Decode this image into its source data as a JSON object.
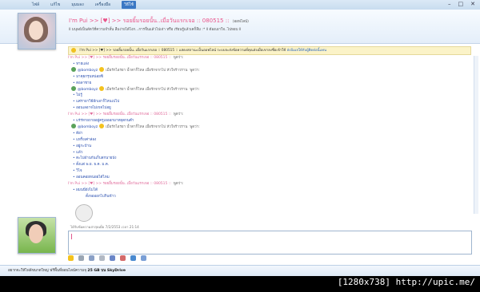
{
  "menu": [
    "ไฟล์",
    "แก้ไข",
    "มุมมอง",
    "เครื่องมือ",
    "วิธีใช้"
  ],
  "window_buttons": [
    "–",
    "□",
    "✕"
  ],
  "contact": {
    "name": "I'm Pui >> [♥] >> รอยยิ้มรอยนั้น..เมื่อวันแรกเจอ :: 080515 ::",
    "status": "(ออฟไลน์)",
    "message": "ll มนุษย์เป็นสัตว์ที่ความจำสั้น ลืมง่ายได้ไงก...การจื่นแล้วไปเจ่า หรือ เรียนรู้แล้วเคก็ลืม :* ll ต้องเอาใจ..ไปหอบ ll"
  },
  "notice": {
    "text": "I'm Pui >> [♥] >> รอยยิ้มรอยนั้น..เมื่อวันแรกเจอ :: 080515 :: แสดงสถานะเป็นออฟไลน์ ระบบจะส่งข้อความที่คุณส่งเมื่อเขาลงชื่อเข้าใช้",
    "link": "ส่งอีเมลให้กับผู้ติดต่อนี้แทน"
  },
  "chat": [
    {
      "kind": "header",
      "who": "pink",
      "text": "I'm Pui >> [♥] >> รอยยิ้มรอยนั้น..เมื่อวันแรกเจอ :: 080515 ::",
      "say": "พูดว่า:"
    },
    {
      "kind": "msg",
      "text": "• หายแล่ง"
    },
    {
      "kind": "header",
      "who": "buddy",
      "text": "@bomboyz",
      "tail": "เมื่อรักไอรยา น้ำตาก็ไหล เมื่อรักจากไป หัวใจร้าวราน",
      "say": "พูดว่า:"
    },
    {
      "kind": "msg",
      "text": "• มาคุยกรุนหน่อยซิ"
    },
    {
      "kind": "msg",
      "text": "• ตอลาชาย"
    },
    {
      "kind": "header",
      "who": "buddy",
      "text": "@bomboyz",
      "tail": "เมื่อรักไอรยา น้ำตาก็ไหล เมื่อรักจากไป หัวใจร้าวราน",
      "say": "พูดว่า:"
    },
    {
      "kind": "msg",
      "text": "• ไม่รู้"
    },
    {
      "kind": "msg",
      "text": "• แค่รายาวิธีอีกเอาก็ไหนเปไป"
    },
    {
      "kind": "msg",
      "text": "• ออนเลอาจไม่เขจไปอยู"
    },
    {
      "kind": "header",
      "who": "pink",
      "text": "I'm Pui >> [♥] >> รอยยิ้มรอยนั้น..เมื่อวันแรกเจอ :: 080515 ::",
      "say": "พูดว่า:"
    },
    {
      "kind": "msg",
      "text": "• แร่ร่ทายถายอยู่ครูเอออกมาทยุดกนคำ"
    },
    {
      "kind": "header",
      "who": "buddy",
      "text": "@bomboyz",
      "tail": "เมื่อรักไอรยา น้ำตาก็ไหล เมื่อรักจากไป หัวใจร้าวราน",
      "say": "พูดว่า:"
    },
    {
      "kind": "msg",
      "text": "• ดีอ่า"
    },
    {
      "kind": "msg",
      "text": "• แหร็งเค่าล่อง"
    },
    {
      "kind": "msg",
      "text": "• อยู่กะบ้าน"
    },
    {
      "kind": "msg",
      "text": "• แล้ว"
    },
    {
      "kind": "msg",
      "text": "• ตะไปฝ่านกันเก็บสกนายบัง"
    },
    {
      "kind": "msg",
      "text": "• ตั้งแต่ พ.ย. ธ.ค. ม.ค."
    },
    {
      "kind": "msg",
      "text": "• วิไจ"
    },
    {
      "kind": "msg",
      "text": "• ออนคอยหน่อยได้ไหม"
    },
    {
      "kind": "header",
      "who": "pink",
      "text": "I'm Pui >> [♥] >> รอยยิ้มรอยนั้น..เมื่อวันแรกเจอ :: 080515 ::",
      "say": "พูดว่า:"
    },
    {
      "kind": "msg",
      "text": "• ผมนนี่ยังไม่ได้"
    },
    {
      "kind": "msg",
      "text": "ตั้งจอออกไปกินข้าว",
      "indent": true
    }
  ],
  "timestamp": "ได้รับข้อความล่าสุดเมื่อ 7/2/2553 เวลา 21:14",
  "toolbar_icons": [
    "emoticon-icon",
    "wink-icon",
    "nudge-icon",
    "voice-clip-icon",
    "font-icon",
    "background-icon",
    "handwriting-icon",
    "gift-icon"
  ],
  "status": {
    "text": "อยากจะให้ไฟล์ขนาดใหญ่ ฟรีพื้นที่ออนไลน์ความจุ",
    "bold": "25 GB บน SkyDrive"
  },
  "watermark": "[1280x738] http://upic.me/"
}
